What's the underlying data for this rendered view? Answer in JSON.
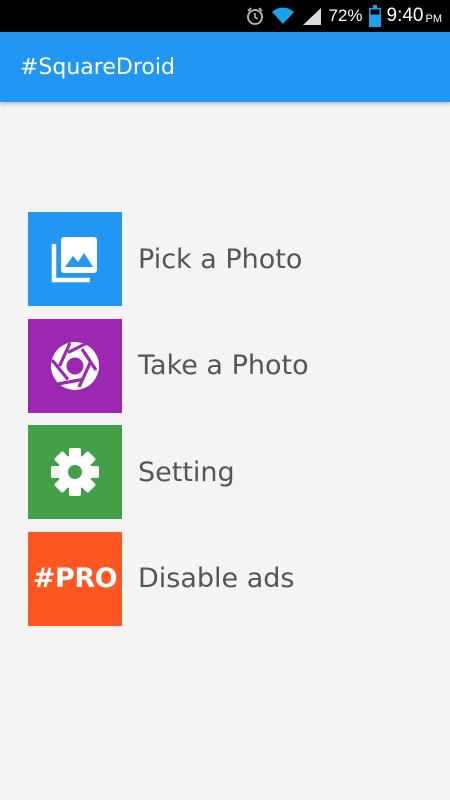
{
  "status_bar": {
    "battery": "72%",
    "time": "9:40",
    "ampm": "PM",
    "icons": [
      "alarm-icon",
      "wifi-icon",
      "signal-icon",
      "battery-icon"
    ]
  },
  "app_bar": {
    "title": "#SquareDroid",
    "color": "#2196f3"
  },
  "menu": {
    "items": [
      {
        "label": "Pick a Photo",
        "icon": "gallery-icon",
        "color": "#2196f3"
      },
      {
        "label": "Take a Photo",
        "icon": "camera-shutter-icon",
        "color": "#9c27b0"
      },
      {
        "label": "Setting",
        "icon": "gear-icon",
        "color": "#43a047"
      },
      {
        "label": "Disable ads",
        "icon": "pro-badge",
        "icon_text": "#PRO",
        "color": "#ff5722"
      }
    ]
  }
}
